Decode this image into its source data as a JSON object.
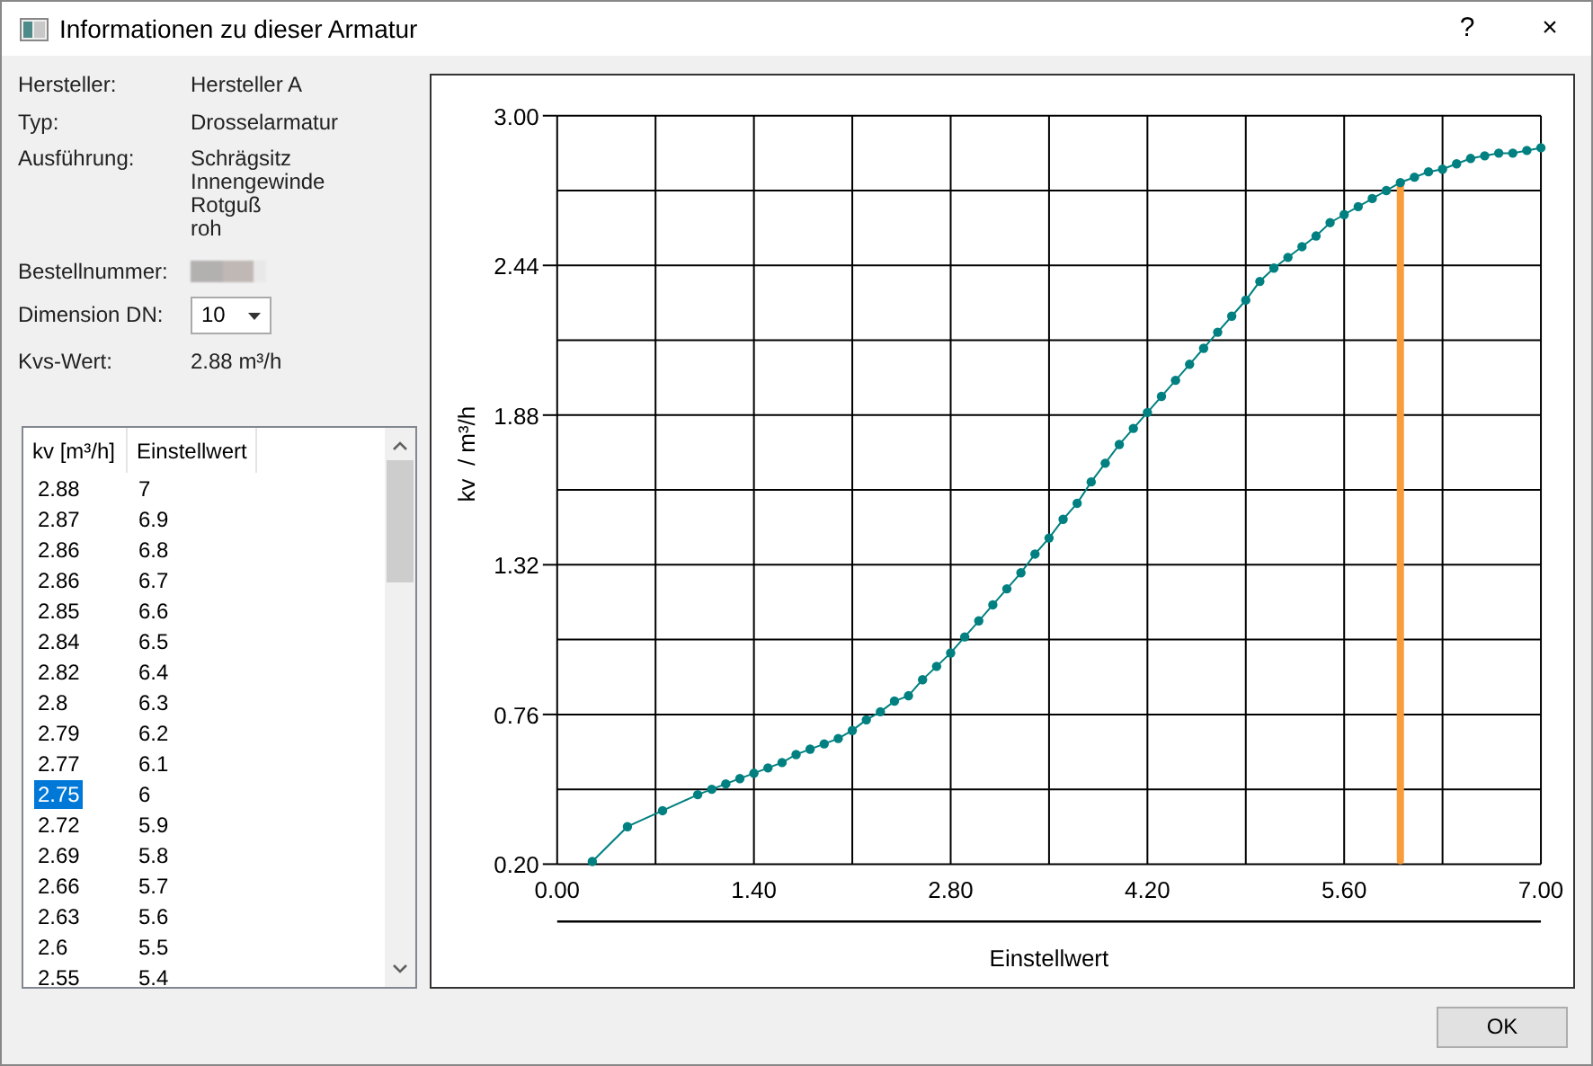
{
  "window": {
    "title": "Informationen zu dieser Armatur",
    "help": "?",
    "close": "×"
  },
  "info": [
    {
      "label": "Hersteller:",
      "kind": "text",
      "value": [
        "Hersteller A"
      ]
    },
    {
      "label": "Typ:",
      "kind": "text",
      "value": [
        "Drosselarmatur"
      ]
    },
    {
      "label": "Ausführung:",
      "kind": "text",
      "value": [
        "Schrägsitz",
        "Innengewinde",
        "Rotguß",
        "roh"
      ]
    },
    {
      "label": "Bestellnummer:",
      "kind": "redacted"
    },
    {
      "label": "Dimension DN:",
      "kind": "dropdown",
      "value": [
        "10"
      ]
    },
    {
      "label": "Kvs-Wert:",
      "kind": "text",
      "value": [
        "2.88 m³/h"
      ]
    }
  ],
  "table": {
    "columns": [
      "kv [m³/h]",
      "Einstellwert"
    ],
    "rows": [
      {
        "cells": [
          "2.88",
          "7"
        ],
        "selected": false
      },
      {
        "cells": [
          "2.87",
          "6.9"
        ],
        "selected": false
      },
      {
        "cells": [
          "2.86",
          "6.8"
        ],
        "selected": false
      },
      {
        "cells": [
          "2.86",
          "6.7"
        ],
        "selected": false
      },
      {
        "cells": [
          "2.85",
          "6.6"
        ],
        "selected": false
      },
      {
        "cells": [
          "2.84",
          "6.5"
        ],
        "selected": false
      },
      {
        "cells": [
          "2.82",
          "6.4"
        ],
        "selected": false
      },
      {
        "cells": [
          "2.8",
          "6.3"
        ],
        "selected": false
      },
      {
        "cells": [
          "2.79",
          "6.2"
        ],
        "selected": false
      },
      {
        "cells": [
          "2.77",
          "6.1"
        ],
        "selected": false
      },
      {
        "cells": [
          "2.75",
          "6"
        ],
        "selected": true
      },
      {
        "cells": [
          "2.72",
          "5.9"
        ],
        "selected": false
      },
      {
        "cells": [
          "2.69",
          "5.8"
        ],
        "selected": false
      },
      {
        "cells": [
          "2.66",
          "5.7"
        ],
        "selected": false
      },
      {
        "cells": [
          "2.63",
          "5.6"
        ],
        "selected": false
      },
      {
        "cells": [
          "2.6",
          "5.5"
        ],
        "selected": false
      },
      {
        "cells": [
          "2.55",
          "5.4"
        ],
        "selected": false
      }
    ]
  },
  "chart": {
    "chart_data": {
      "type": "line",
      "xlabel": "Einstellwert",
      "ylabel": "kv  / m³/h",
      "xlim": [
        0,
        7
      ],
      "ylim": [
        0.2,
        3
      ],
      "xticks": [
        {
          "value": 0,
          "label": "0.00"
        },
        {
          "value": 1.4,
          "label": "1.40"
        },
        {
          "value": 2.8,
          "label": "2.80"
        },
        {
          "value": 4.2,
          "label": "4.20"
        },
        {
          "value": 5.6,
          "label": "5.60"
        },
        {
          "value": 7,
          "label": "7.00"
        }
      ],
      "yticks": [
        {
          "value": 0.2,
          "label": "0.20"
        },
        {
          "value": 0.76,
          "label": "0.76"
        },
        {
          "value": 1.32,
          "label": "1.32"
        },
        {
          "value": 1.88,
          "label": "1.88"
        },
        {
          "value": 2.44,
          "label": "2.44"
        },
        {
          "value": 3,
          "label": "3.00"
        }
      ],
      "x": [
        0.25,
        0.5,
        0.75,
        1,
        1.1,
        1.2,
        1.3,
        1.4,
        1.5,
        1.6,
        1.7,
        1.8,
        1.9,
        2,
        2.1,
        2.2,
        2.3,
        2.4,
        2.5,
        2.6,
        2.7,
        2.8,
        2.9,
        3,
        3.1,
        3.2,
        3.3,
        3.4,
        3.5,
        3.6,
        3.7,
        3.8,
        3.9,
        4,
        4.1,
        4.2,
        4.3,
        4.4,
        4.5,
        4.6,
        4.7,
        4.8,
        4.9,
        5,
        5.1,
        5.2,
        5.3,
        5.4,
        5.5,
        5.6,
        5.7,
        5.8,
        5.9,
        6,
        6.1,
        6.2,
        6.3,
        6.4,
        6.5,
        6.6,
        6.7,
        6.8,
        6.9,
        7
      ],
      "series": [
        {
          "color": "#008080",
          "marker": "o",
          "values": [
            0.21,
            0.34,
            0.4,
            0.46,
            0.48,
            0.5,
            0.52,
            0.54,
            0.56,
            0.58,
            0.61,
            0.63,
            0.65,
            0.67,
            0.7,
            0.74,
            0.77,
            0.81,
            0.83,
            0.89,
            0.94,
            0.99,
            1.05,
            1.11,
            1.17,
            1.23,
            1.29,
            1.36,
            1.42,
            1.49,
            1.55,
            1.63,
            1.7,
            1.77,
            1.83,
            1.89,
            1.95,
            2.01,
            2.07,
            2.13,
            2.19,
            2.25,
            2.31,
            2.38,
            2.43,
            2.47,
            2.51,
            2.55,
            2.6,
            2.63,
            2.66,
            2.69,
            2.72,
            2.75,
            2.77,
            2.79,
            2.8,
            2.82,
            2.84,
            2.85,
            2.86,
            2.86,
            2.87,
            2.88
          ]
        }
      ],
      "grid": true,
      "ref_lines": [
        {
          "axis": "x",
          "value": 6,
          "color": "#f89c3c"
        }
      ]
    }
  },
  "buttons": [
    "OK"
  ]
}
